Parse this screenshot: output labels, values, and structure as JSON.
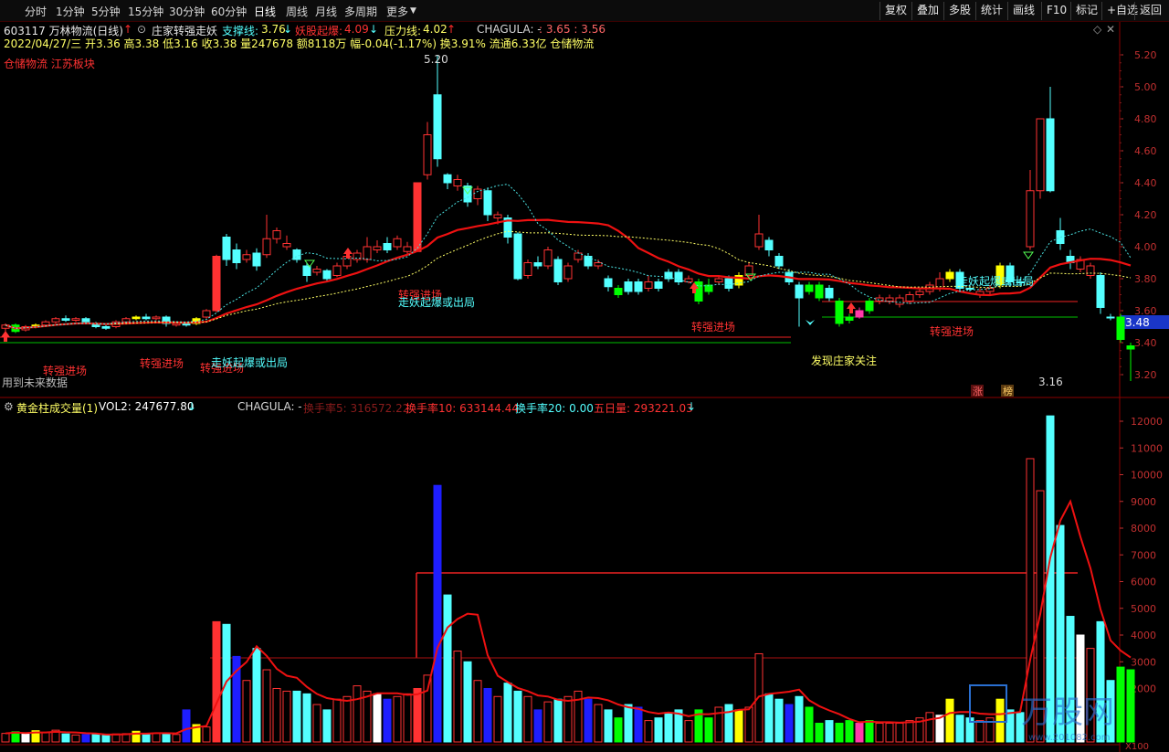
{
  "toolbar": {
    "periods": [
      "分时",
      "1分钟",
      "5分钟",
      "15分钟",
      "30分钟",
      "60分钟",
      "日线",
      "周线",
      "月线",
      "多周期",
      "更多"
    ],
    "active_period": "日线",
    "right_buttons": [
      "复权",
      "叠加",
      "多股",
      "统计",
      "画线",
      "F10",
      "标记",
      "+自选",
      "返回"
    ]
  },
  "header": {
    "stock_title": "603117 万林物流(日线)",
    "formula_name": "庄家转强走妖",
    "support_label": "支撑线:",
    "support_value": "3.76",
    "demon_label": "妖股起爆:",
    "demon_value": "4.09",
    "pressure_label": "压力线:",
    "pressure_value": "4.02",
    "chagula": "CHAGULA: -",
    "chagula_vals": ": 3.65 : 3.56",
    "ohlc_line": "2022/04/27/三 开3.36 高3.38 低3.16 收3.38 量247678 额8118万 幅-0.04(-1.17%) 换3.91% 流通6.33亿 仓储物流",
    "sector": "仓储物流 江苏板块",
    "future_data": "用到未来数据"
  },
  "volume_header": {
    "title": "黄金柱成交量(1)",
    "vol2": "VOL2: 247677.80",
    "chagula": "CHAGULA: -",
    "turnover5": "换手率5: 316572.22",
    "turnover10": "换手率10: 633144.44",
    "turnover20": "换手率20: 0.00",
    "five_day": "五日量: 293221.03"
  },
  "price_axis": {
    "ticks": [
      "5.20",
      "5.00",
      "4.80",
      "4.60",
      "4.40",
      "4.20",
      "4.00",
      "3.80",
      "3.60",
      "3.40",
      "3.20"
    ],
    "current_price": "3.48"
  },
  "volume_axis": {
    "ticks": [
      "12000",
      "11000",
      "10000",
      "9000",
      "8000",
      "7000",
      "6000",
      "5000",
      "4000",
      "3000",
      "2000"
    ],
    "unit": "X100"
  },
  "annotations": {
    "high_label": "5.20",
    "low_label": "3.16",
    "zhuanqiang": "转强进场",
    "zouyao": "走妖起爆或出局",
    "discover": "发现庄家关注",
    "zhang": "涨",
    "bang": "榜"
  },
  "watermark": {
    "brand": "万股网",
    "site": "www.201082.com"
  },
  "colors": {
    "up": "#ff3232",
    "down": "#54ffff",
    "ma_red": "#ee1111",
    "ma_yellow": "#ffff66",
    "ma_cyan": "#4ae0e0",
    "yellow_bar": "#ffff00",
    "green_bar": "#00ff00",
    "blue_bar": "#1e1eff",
    "magenta_bar": "#ff3aa8"
  },
  "chart_data": {
    "type": "candlestick",
    "price_range": [
      3.1,
      5.3
    ],
    "volume_range": [
      0,
      12500
    ],
    "candles": [
      {
        "o": 3.49,
        "c": 3.51,
        "h": 3.52,
        "l": 3.47,
        "k": "up",
        "v": 320
      },
      {
        "o": 3.51,
        "c": 3.47,
        "h": 3.52,
        "l": 3.46,
        "k": "grn",
        "v": 380
      },
      {
        "o": 3.48,
        "c": 3.5,
        "h": 3.51,
        "l": 3.47,
        "k": "up",
        "v": 300
      },
      {
        "o": 3.5,
        "c": 3.51,
        "h": 3.52,
        "l": 3.49,
        "k": "yel",
        "v": 420
      },
      {
        "o": 3.51,
        "c": 3.53,
        "h": 3.54,
        "l": 3.5,
        "k": "up",
        "v": 360
      },
      {
        "o": 3.53,
        "c": 3.55,
        "h": 3.56,
        "l": 3.52,
        "k": "up",
        "v": 440
      },
      {
        "o": 3.55,
        "c": 3.54,
        "h": 3.57,
        "l": 3.53,
        "k": "dn",
        "v": 300
      },
      {
        "o": 3.54,
        "c": 3.55,
        "h": 3.56,
        "l": 3.53,
        "k": "up",
        "v": 260
      },
      {
        "o": 3.55,
        "c": 3.53,
        "h": 3.56,
        "l": 3.52,
        "k": "dn",
        "v": 280
      },
      {
        "o": 3.52,
        "c": 3.5,
        "h": 3.53,
        "l": 3.49,
        "k": "dn",
        "v": 300
      },
      {
        "o": 3.5,
        "c": 3.49,
        "h": 3.51,
        "l": 3.48,
        "k": "dn",
        "v": 250
      },
      {
        "o": 3.5,
        "c": 3.53,
        "h": 3.54,
        "l": 3.49,
        "k": "up",
        "v": 300
      },
      {
        "o": 3.53,
        "c": 3.55,
        "h": 3.56,
        "l": 3.52,
        "k": "up",
        "v": 310
      },
      {
        "o": 3.55,
        "c": 3.56,
        "h": 3.57,
        "l": 3.54,
        "k": "yel",
        "v": 400
      },
      {
        "o": 3.56,
        "c": 3.55,
        "h": 3.58,
        "l": 3.54,
        "k": "dn",
        "v": 300
      },
      {
        "o": 3.55,
        "c": 3.56,
        "h": 3.57,
        "l": 3.54,
        "k": "up",
        "v": 330
      },
      {
        "o": 3.56,
        "c": 3.52,
        "h": 3.57,
        "l": 3.5,
        "k": "dn",
        "v": 300
      },
      {
        "o": 3.51,
        "c": 3.52,
        "h": 3.53,
        "l": 3.5,
        "k": "up",
        "v": 280
      },
      {
        "o": 3.52,
        "c": 3.51,
        "h": 3.53,
        "l": 3.5,
        "k": "dn",
        "v": 1200
      },
      {
        "o": 3.52,
        "c": 3.55,
        "h": 3.56,
        "l": 3.51,
        "k": "yel",
        "v": 650
      },
      {
        "o": 3.56,
        "c": 3.6,
        "h": 3.61,
        "l": 3.55,
        "k": "up",
        "v": 560
      },
      {
        "o": 3.6,
        "c": 3.94,
        "h": 3.95,
        "l": 3.59,
        "k": "redsolid",
        "v": 4500
      },
      {
        "o": 3.92,
        "c": 4.06,
        "h": 4.08,
        "l": 3.88,
        "k": "dn",
        "v": 4400
      },
      {
        "o": 3.98,
        "c": 3.9,
        "h": 4.02,
        "l": 3.86,
        "k": "dn",
        "v": 3200
      },
      {
        "o": 3.92,
        "c": 3.95,
        "h": 3.98,
        "l": 3.9,
        "k": "up",
        "v": 2300
      },
      {
        "o": 3.96,
        "c": 3.88,
        "h": 3.99,
        "l": 3.85,
        "k": "dn",
        "v": 3500
      },
      {
        "o": 3.95,
        "c": 4.05,
        "h": 4.2,
        "l": 3.93,
        "k": "up",
        "v": 2700
      },
      {
        "o": 4.05,
        "c": 4.1,
        "h": 4.12,
        "l": 4.02,
        "k": "up",
        "v": 2000
      },
      {
        "o": 4.02,
        "c": 4.0,
        "h": 4.07,
        "l": 3.98,
        "k": "up",
        "v": 1900
      },
      {
        "o": 3.98,
        "c": 3.92,
        "h": 3.99,
        "l": 3.9,
        "k": "dn",
        "v": 1900
      },
      {
        "o": 3.88,
        "c": 3.82,
        "h": 3.9,
        "l": 3.78,
        "k": "dn",
        "v": 1800
      },
      {
        "o": 3.84,
        "c": 3.86,
        "h": 3.88,
        "l": 3.82,
        "k": "up",
        "v": 1400
      },
      {
        "o": 3.85,
        "c": 3.8,
        "h": 3.86,
        "l": 3.78,
        "k": "dn",
        "v": 1200
      },
      {
        "o": 3.82,
        "c": 3.88,
        "h": 3.9,
        "l": 3.81,
        "k": "up",
        "v": 1600
      },
      {
        "o": 3.88,
        "c": 3.94,
        "h": 3.96,
        "l": 3.86,
        "k": "up",
        "v": 1700
      },
      {
        "o": 3.96,
        "c": 3.92,
        "h": 3.98,
        "l": 3.9,
        "k": "up",
        "v": 2100
      },
      {
        "o": 3.92,
        "c": 4.0,
        "h": 4.06,
        "l": 3.9,
        "k": "up",
        "v": 1900
      },
      {
        "o": 4.0,
        "c": 3.98,
        "h": 4.04,
        "l": 3.96,
        "k": "up",
        "v": 1800
      },
      {
        "o": 3.98,
        "c": 4.02,
        "h": 4.06,
        "l": 3.96,
        "k": "dn",
        "v": 1600
      },
      {
        "o": 4.05,
        "c": 4.0,
        "h": 4.07,
        "l": 3.98,
        "k": "up",
        "v": 1700
      },
      {
        "o": 4.0,
        "c": 3.97,
        "h": 4.03,
        "l": 3.95,
        "k": "up",
        "v": 1800
      },
      {
        "o": 3.97,
        "c": 4.4,
        "h": 4.4,
        "l": 3.97,
        "k": "redsolid",
        "v": 2000
      },
      {
        "o": 4.45,
        "c": 4.7,
        "h": 4.78,
        "l": 4.42,
        "k": "up",
        "v": 2500
      },
      {
        "o": 4.55,
        "c": 4.95,
        "h": 5.2,
        "l": 4.5,
        "k": "dn",
        "v": 9600
      },
      {
        "o": 4.45,
        "c": 4.4,
        "h": 4.46,
        "l": 4.36,
        "k": "dn",
        "v": 5500
      },
      {
        "o": 4.42,
        "c": 4.38,
        "h": 4.45,
        "l": 4.35,
        "k": "up",
        "v": 3400
      },
      {
        "o": 4.38,
        "c": 4.28,
        "h": 4.4,
        "l": 4.25,
        "k": "dn",
        "v": 3000
      },
      {
        "o": 4.3,
        "c": 4.36,
        "h": 4.38,
        "l": 4.26,
        "k": "up",
        "v": 2300
      },
      {
        "o": 4.35,
        "c": 4.2,
        "h": 4.37,
        "l": 4.16,
        "k": "dn",
        "v": 2000
      },
      {
        "o": 4.2,
        "c": 4.18,
        "h": 4.22,
        "l": 4.14,
        "k": "up",
        "v": 1700
      },
      {
        "o": 4.18,
        "c": 4.06,
        "h": 4.2,
        "l": 4.02,
        "k": "dn",
        "v": 2200
      },
      {
        "o": 4.08,
        "c": 3.8,
        "h": 4.09,
        "l": 3.79,
        "k": "dn",
        "v": 1900
      },
      {
        "o": 3.82,
        "c": 3.9,
        "h": 3.92,
        "l": 3.8,
        "k": "up",
        "v": 1700
      },
      {
        "o": 3.9,
        "c": 3.88,
        "h": 3.94,
        "l": 3.86,
        "k": "dn",
        "v": 1200
      },
      {
        "o": 3.88,
        "c": 3.98,
        "h": 4.0,
        "l": 3.86,
        "k": "up",
        "v": 1500
      },
      {
        "o": 3.92,
        "c": 3.78,
        "h": 3.94,
        "l": 3.76,
        "k": "dn",
        "v": 1600
      },
      {
        "o": 3.8,
        "c": 3.88,
        "h": 3.9,
        "l": 3.78,
        "k": "up",
        "v": 1700
      },
      {
        "o": 3.92,
        "c": 3.96,
        "h": 3.98,
        "l": 3.9,
        "k": "up",
        "v": 1900
      },
      {
        "o": 3.88,
        "c": 3.94,
        "h": 3.96,
        "l": 3.86,
        "k": "dn",
        "v": 1600
      },
      {
        "o": 3.88,
        "c": 3.9,
        "h": 3.92,
        "l": 3.86,
        "k": "up",
        "v": 1400
      },
      {
        "o": 3.8,
        "c": 3.75,
        "h": 3.82,
        "l": 3.72,
        "k": "dn",
        "v": 1200
      },
      {
        "o": 3.74,
        "c": 3.7,
        "h": 3.76,
        "l": 3.68,
        "k": "grn",
        "v": 900
      },
      {
        "o": 3.72,
        "c": 3.78,
        "h": 3.8,
        "l": 3.7,
        "k": "dn",
        "v": 1400
      },
      {
        "o": 3.78,
        "c": 3.72,
        "h": 3.8,
        "l": 3.7,
        "k": "dn",
        "v": 1300
      },
      {
        "o": 3.74,
        "c": 3.78,
        "h": 3.82,
        "l": 3.72,
        "k": "up",
        "v": 800
      },
      {
        "o": 3.78,
        "c": 3.74,
        "h": 3.8,
        "l": 3.72,
        "k": "dn",
        "v": 900
      },
      {
        "o": 3.8,
        "c": 3.84,
        "h": 3.86,
        "l": 3.78,
        "k": "dn",
        "v": 1100
      },
      {
        "o": 3.84,
        "c": 3.78,
        "h": 3.86,
        "l": 3.76,
        "k": "dn",
        "v": 1200
      },
      {
        "o": 3.78,
        "c": 3.8,
        "h": 3.82,
        "l": 3.77,
        "k": "up",
        "v": 800
      },
      {
        "o": 3.78,
        "c": 3.66,
        "h": 3.8,
        "l": 3.64,
        "k": "grn",
        "v": 1200
      },
      {
        "o": 3.72,
        "c": 3.76,
        "h": 3.8,
        "l": 3.7,
        "k": "grn",
        "v": 900
      },
      {
        "o": 3.78,
        "c": 3.8,
        "h": 3.82,
        "l": 3.76,
        "k": "up",
        "v": 1300
      },
      {
        "o": 3.8,
        "c": 3.74,
        "h": 3.82,
        "l": 3.72,
        "k": "dn",
        "v": 1400
      },
      {
        "o": 3.76,
        "c": 3.82,
        "h": 3.84,
        "l": 3.74,
        "k": "yel",
        "v": 1200
      },
      {
        "o": 3.82,
        "c": 3.88,
        "h": 3.9,
        "l": 3.8,
        "k": "up",
        "v": 1300
      },
      {
        "o": 4.0,
        "c": 4.08,
        "h": 4.2,
        "l": 3.98,
        "k": "up",
        "v": 3300
      },
      {
        "o": 4.04,
        "c": 3.98,
        "h": 4.06,
        "l": 3.94,
        "k": "dn",
        "v": 1800
      },
      {
        "o": 3.94,
        "c": 3.88,
        "h": 3.96,
        "l": 3.86,
        "k": "dn",
        "v": 1600
      },
      {
        "o": 3.84,
        "c": 3.78,
        "h": 3.86,
        "l": 3.76,
        "k": "dn",
        "v": 1400
      },
      {
        "o": 3.76,
        "c": 3.68,
        "h": 3.78,
        "l": 3.5,
        "k": "dn",
        "v": 1700
      },
      {
        "o": 3.72,
        "c": 3.76,
        "h": 3.78,
        "l": 3.7,
        "k": "grn",
        "v": 1300
      },
      {
        "o": 3.76,
        "c": 3.68,
        "h": 3.78,
        "l": 3.66,
        "k": "grn",
        "v": 700
      },
      {
        "o": 3.68,
        "c": 3.74,
        "h": 3.76,
        "l": 3.66,
        "k": "dn",
        "v": 800
      },
      {
        "o": 3.66,
        "c": 3.52,
        "h": 3.68,
        "l": 3.5,
        "k": "grn",
        "v": 700
      },
      {
        "o": 3.54,
        "c": 3.56,
        "h": 3.58,
        "l": 3.52,
        "k": "grn",
        "v": 800
      },
      {
        "o": 3.56,
        "c": 3.6,
        "h": 3.62,
        "l": 3.55,
        "k": "mag",
        "v": 700
      },
      {
        "o": 3.6,
        "c": 3.66,
        "h": 3.68,
        "l": 3.58,
        "k": "grn",
        "v": 800
      },
      {
        "o": 3.66,
        "c": 3.68,
        "h": 3.7,
        "l": 3.64,
        "k": "up",
        "v": 700
      },
      {
        "o": 3.66,
        "c": 3.68,
        "h": 3.7,
        "l": 3.64,
        "k": "up",
        "v": 700
      },
      {
        "o": 3.68,
        "c": 3.64,
        "h": 3.7,
        "l": 3.62,
        "k": "up",
        "v": 700
      },
      {
        "o": 3.66,
        "c": 3.7,
        "h": 3.72,
        "l": 3.64,
        "k": "up",
        "v": 800
      },
      {
        "o": 3.7,
        "c": 3.72,
        "h": 3.74,
        "l": 3.68,
        "k": "up",
        "v": 900
      },
      {
        "o": 3.72,
        "c": 3.76,
        "h": 3.78,
        "l": 3.7,
        "k": "up",
        "v": 1100
      },
      {
        "o": 3.74,
        "c": 3.8,
        "h": 3.84,
        "l": 3.72,
        "k": "up",
        "v": 1000
      },
      {
        "o": 3.8,
        "c": 3.84,
        "h": 3.86,
        "l": 3.78,
        "k": "yel",
        "v": 1600
      },
      {
        "o": 3.84,
        "c": 3.74,
        "h": 3.86,
        "l": 3.72,
        "k": "dn",
        "v": 1000
      },
      {
        "o": 3.74,
        "c": 3.74,
        "h": 3.76,
        "l": 3.72,
        "k": "dn",
        "v": 900
      },
      {
        "o": 3.72,
        "c": 3.7,
        "h": 3.74,
        "l": 3.68,
        "k": "up",
        "v": 800
      },
      {
        "o": 3.72,
        "c": 3.74,
        "h": 3.76,
        "l": 3.7,
        "k": "up",
        "v": 900
      },
      {
        "o": 3.76,
        "c": 3.88,
        "h": 3.9,
        "l": 3.74,
        "k": "yel",
        "v": 1600
      },
      {
        "o": 3.88,
        "c": 3.78,
        "h": 3.9,
        "l": 3.76,
        "k": "dn",
        "v": 1200
      },
      {
        "o": 3.78,
        "c": 3.78,
        "h": 3.8,
        "l": 3.76,
        "k": "dn",
        "v": 1100
      },
      {
        "o": 4.0,
        "c": 4.35,
        "h": 4.48,
        "l": 3.98,
        "k": "up",
        "v": 10600
      },
      {
        "o": 4.35,
        "c": 4.8,
        "h": 4.8,
        "l": 4.3,
        "k": "up",
        "v": 9400
      },
      {
        "o": 4.35,
        "c": 4.8,
        "h": 5.0,
        "l": 4.34,
        "k": "dn",
        "v": 12200
      },
      {
        "o": 4.1,
        "c": 4.02,
        "h": 4.18,
        "l": 3.98,
        "k": "dn",
        "v": 8100
      },
      {
        "o": 3.94,
        "c": 3.9,
        "h": 3.98,
        "l": 3.86,
        "k": "dn",
        "v": 4700
      },
      {
        "o": 3.86,
        "c": 3.92,
        "h": 3.94,
        "l": 3.84,
        "k": "up",
        "v": 4000
      },
      {
        "o": 3.82,
        "c": 3.88,
        "h": 3.9,
        "l": 3.8,
        "k": "up",
        "v": 3500
      },
      {
        "o": 3.82,
        "c": 3.62,
        "h": 3.84,
        "l": 3.58,
        "k": "dn",
        "v": 4500
      },
      {
        "o": 3.56,
        "c": 3.56,
        "h": 3.58,
        "l": 3.54,
        "k": "dn",
        "v": 2300
      },
      {
        "o": 3.56,
        "c": 3.42,
        "h": 3.58,
        "l": 3.4,
        "k": "grn",
        "v": 2800
      },
      {
        "o": 3.36,
        "c": 3.38,
        "h": 3.4,
        "l": 3.16,
        "k": "grn",
        "v": 2700
      }
    ]
  }
}
